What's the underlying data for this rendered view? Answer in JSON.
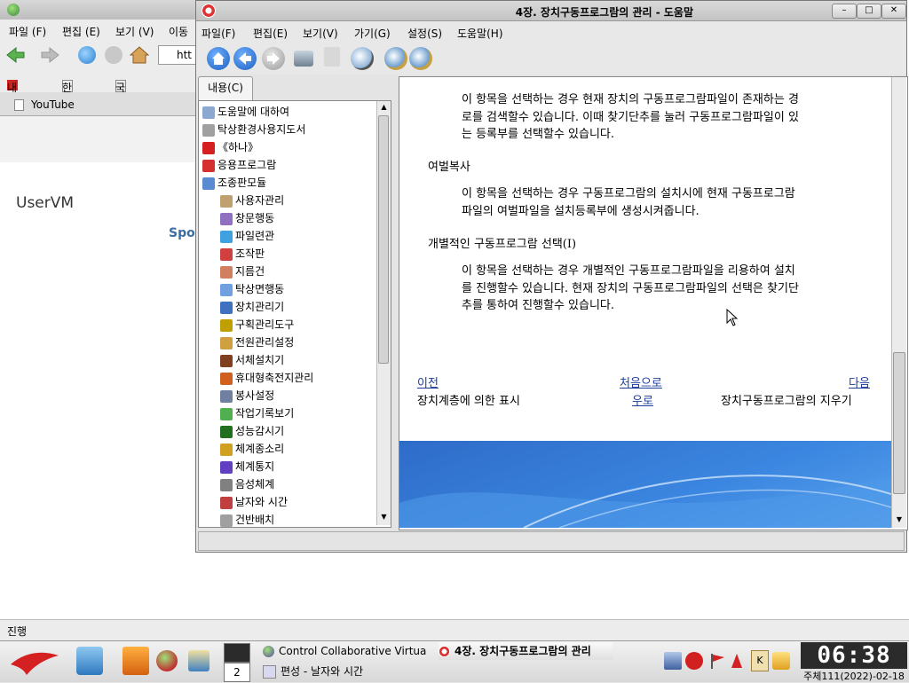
{
  "browser": {
    "menu": [
      "파일 (F)",
      "편집 (E)",
      "보기 (V)",
      "이동"
    ],
    "url_partial": "htt",
    "bookmarks": [
      "내나라",
      "한마음",
      "국가망정보쎈"
    ],
    "tab_label": "YouTube",
    "page_heading": "UserVM",
    "page_link_partial": "Spo",
    "status": "진행"
  },
  "help": {
    "title": "4장. 장치구동프로그람의 관리 - 도움말",
    "menu": [
      "파일(F)",
      "편집(E)",
      "보기(V)",
      "가기(G)",
      "설정(S)",
      "도움말(H)"
    ],
    "tab_label": "내용(C)",
    "tree": [
      {
        "label": "도움말에 대하여",
        "icon": "document-icon",
        "indent": 0
      },
      {
        "label": "탁상환경사용지도서",
        "icon": "document-icon",
        "indent": 0
      },
      {
        "label": "《하나》",
        "icon": "hana-icon",
        "indent": 0
      },
      {
        "label": "응용프로그람",
        "icon": "apps-icon",
        "indent": 0
      },
      {
        "label": "조종판모듈",
        "icon": "book-icon",
        "indent": 0
      },
      {
        "label": "사용자관리",
        "icon": "users-icon",
        "indent": 1
      },
      {
        "label": "창문행동",
        "icon": "window-icon",
        "indent": 1
      },
      {
        "label": "파일련관",
        "icon": "speech-icon",
        "indent": 1
      },
      {
        "label": "조작판",
        "icon": "panel-icon",
        "indent": 1
      },
      {
        "label": "지름건",
        "icon": "shortcut-icon",
        "indent": 1
      },
      {
        "label": "탁상면행동",
        "icon": "desktop-icon",
        "indent": 1
      },
      {
        "label": "장치관리기",
        "icon": "device-icon",
        "indent": 1
      },
      {
        "label": "구획관리도구",
        "icon": "partition-icon",
        "indent": 1
      },
      {
        "label": "전원관리설정",
        "icon": "power-icon",
        "indent": 1
      },
      {
        "label": "서체설치기",
        "icon": "font-icon",
        "indent": 1
      },
      {
        "label": "휴대형축전지관리",
        "icon": "battery-icon",
        "indent": 1
      },
      {
        "label": "봉사설정",
        "icon": "service-icon",
        "indent": 1
      },
      {
        "label": "작업기록보기",
        "icon": "log-icon",
        "indent": 1
      },
      {
        "label": "성능감시기",
        "icon": "monitor-icon",
        "indent": 1
      },
      {
        "label": "체계종소리",
        "icon": "bell-icon",
        "indent": 1
      },
      {
        "label": "체계통지",
        "icon": "music-icon",
        "indent": 1
      },
      {
        "label": "음성체계",
        "icon": "speaker-icon",
        "indent": 1
      },
      {
        "label": "날자와 시간",
        "icon": "calendar-icon",
        "indent": 1
      },
      {
        "label": "건반배치",
        "icon": "keyboard-icon",
        "indent": 1
      }
    ],
    "content": {
      "para1": "이 항목을 선택하는 경우 현재 장치의 구동프로그람파일이 존재하는 경로를 검색할수 있습니다. 이때 찾기단추를 눌러 구동프로그람파일이 있는 등록부를 선택할수 있습니다.",
      "para1_lines": [
        "이 항목을 선택하는 경우 현재 장치의 구동프로그람파일이 존재하는 경",
        "로를 검색할수 있습니다. 이때 찾기단추를 눌러 구동프로그람파일이 있",
        "는 등록부를 선택할수 있습니다."
      ],
      "heading2": "여벌복사",
      "para2_lines": [
        "이 항목을 선택하는 경우 구동프로그람의 설치시에 현재 구동프로그람",
        "파일의 여벌파일을 설치등록부에 생성시켜줍니다."
      ],
      "heading3": "개별적인 구동프로그람 선택(I)",
      "para3_lines": [
        "이 항목을 선택하는 경우 개별적인 구동프로그람파일을 리용하여 설치",
        "를 진행할수 있습니다. 현재 장치의 구동프로그람파일의 선택은 찾기단",
        "추를 통하여 진행할수 있습니다."
      ]
    },
    "nav": {
      "prev_label": "이전",
      "prev_desc": "장치계층에 의한 표시",
      "home_label_line1": "처음으로",
      "home_label_line2": "우로",
      "next_label": "다음",
      "next_desc": "장치구동프로그람의 지우기"
    }
  },
  "taskbar": {
    "workspace_number": "2",
    "tasks": [
      "Control Collaborative Virtua",
      "4장. 장치구동프로그람의 관리",
      "편성 - 날자와 시간"
    ],
    "clock": "06:38",
    "date": "주체111(2022)-02-18"
  },
  "colors": {
    "link": "#1c3c9c",
    "banner": "#3b86e0",
    "clock_bg": "#2b2b2b"
  }
}
